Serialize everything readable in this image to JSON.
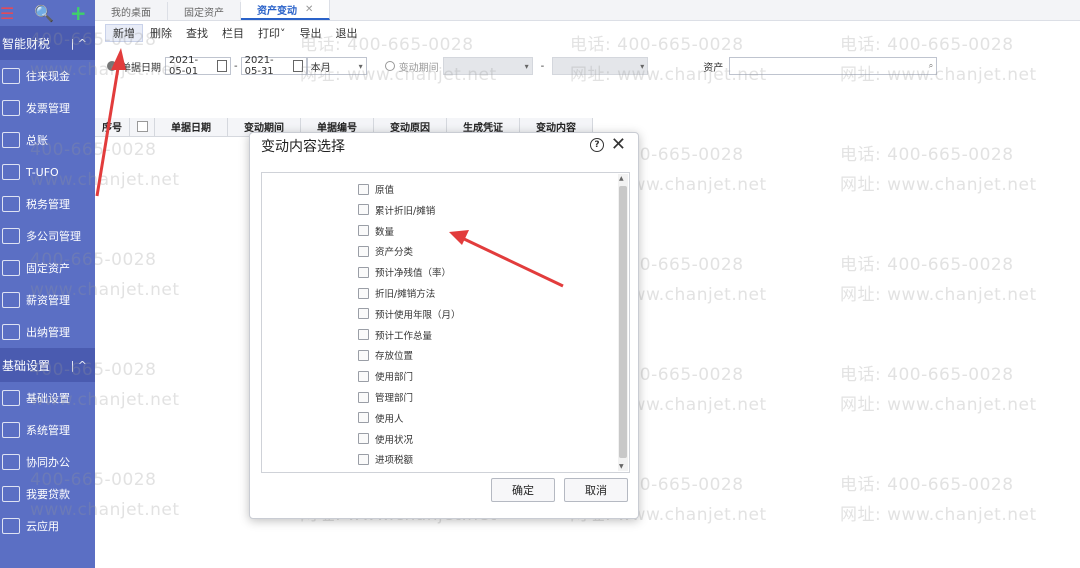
{
  "tabs": [
    {
      "label": "我的桌面"
    },
    {
      "label": "固定资产"
    },
    {
      "label": "资产变动"
    }
  ],
  "toolbar": {
    "buttons": [
      "新增",
      "删除",
      "查找",
      "栏目",
      "打印",
      "导出",
      "退出"
    ]
  },
  "filter": {
    "doc_date_label": "单据日期",
    "date_from": "2021-05-01",
    "date_to": "2021-05-31",
    "period": "本月",
    "change_period_label": "变动期间",
    "asset_label": "资产"
  },
  "grid": {
    "headers": [
      "序号",
      "单据日期",
      "变动期间",
      "单据编号",
      "变动原因",
      "生成凭证",
      "变动内容"
    ]
  },
  "sidebar": {
    "group1": "智能财税",
    "group1_items": [
      "往来现金",
      "发票管理",
      "总账",
      "T-UFO",
      "税务管理",
      "多公司管理",
      "固定资产",
      "薪资管理",
      "出纳管理"
    ],
    "group2": "基础设置",
    "group2_items": [
      "基础设置",
      "系统管理",
      "协同办公",
      "我要贷款",
      "云应用"
    ]
  },
  "modal": {
    "title": "变动内容选择",
    "options": [
      "原值",
      "累计折旧/摊销",
      "数量",
      "资产分类",
      "预计净残值（率）",
      "折旧/摊销方法",
      "预计使用年限（月）",
      "预计工作总量",
      "存放位置",
      "使用部门",
      "管理部门",
      "使用人",
      "使用状况",
      "进项税额"
    ],
    "ok_label": "确定",
    "cancel_label": "取消"
  },
  "watermark": {
    "phone": "电话: 400-665-0028",
    "site": "网址: www.chanjet.net",
    "phone_partial": "400-665-0028",
    "site_partial": "www.chanjet.net"
  },
  "colors": {
    "sidebar": "#5b6fc4",
    "accent": "#2a62c9",
    "arrow": "#e23c3c"
  }
}
